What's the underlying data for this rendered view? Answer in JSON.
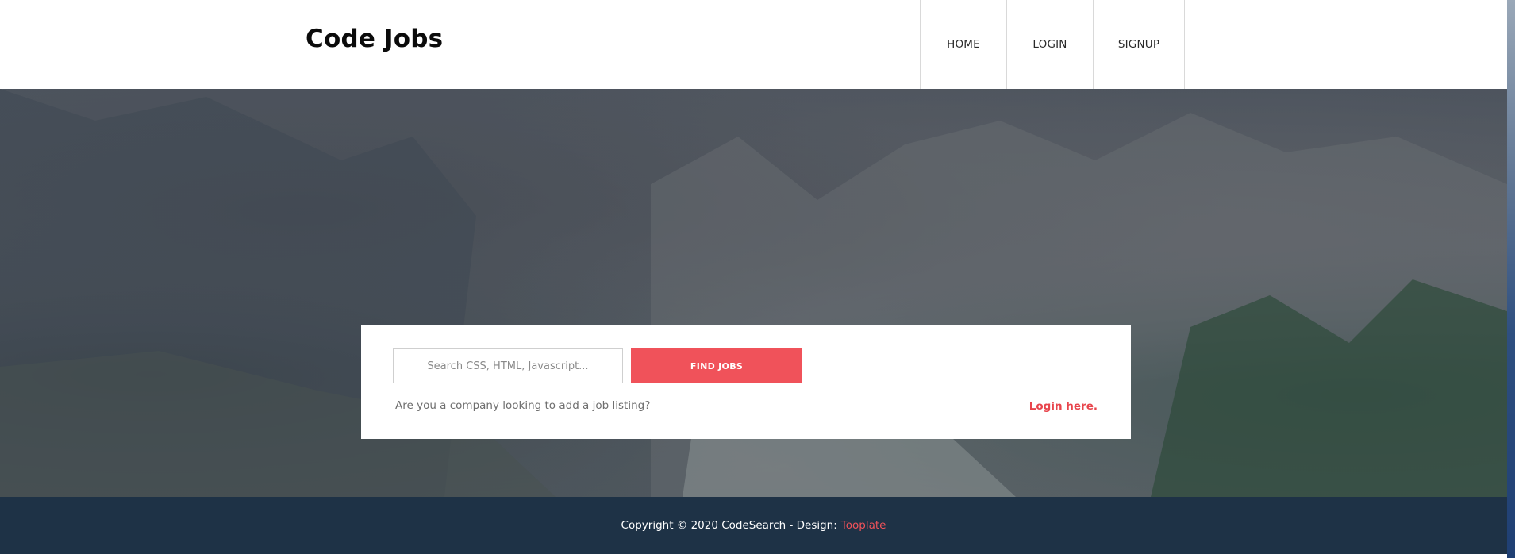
{
  "header": {
    "brand": "Code Jobs",
    "nav": [
      {
        "label": "HOME"
      },
      {
        "label": "LOGIN"
      },
      {
        "label": "SIGNUP"
      }
    ]
  },
  "search": {
    "placeholder": "Search CSS, HTML, Javascript...",
    "value": "",
    "button_label": "FIND JOBS",
    "company_prompt": "Are you a company looking to add a job listing?",
    "login_link": "Login here."
  },
  "footer": {
    "text": "Copyright © 2020 CodeSearch - Design:",
    "link_label": "Tooplate"
  },
  "colors": {
    "accent": "#f0525a",
    "footer_bg": "#1e3246",
    "hero_overlay": "#283240"
  },
  "icons": []
}
